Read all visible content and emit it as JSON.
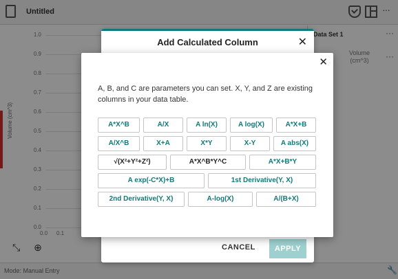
{
  "app": {
    "title": "Untitled"
  },
  "graph": {
    "y_ticks": [
      "1.0",
      "0.9",
      "0.8",
      "0.7",
      "0.6",
      "0.5",
      "0.4",
      "0.3",
      "0.2",
      "0.1",
      "0.0"
    ],
    "y_label": "Volume (cm^3)",
    "x_ticks": [
      "0.0",
      "0.1"
    ]
  },
  "table": {
    "dataset_title": "Data Set 1",
    "column_name_line1": "Volume",
    "column_name_line2": "(cm^3)"
  },
  "status": {
    "mode": "Mode: Manual Entry"
  },
  "dialog": {
    "title": "Add Calculated Column",
    "close_glyph": "✕",
    "cancel_label": "CANCEL",
    "apply_label": "APPLY"
  },
  "chooser": {
    "close_glyph": "✕",
    "description": "A, B, and C are parameters you can set. X, Y, and Z are existing columns in your data table.",
    "formulas": {
      "r1": [
        "A*X^B",
        "A/X",
        "A ln(X)",
        "A log(X)",
        "A*X+B"
      ],
      "r2": [
        "A/X^B",
        "X+A",
        "X*Y",
        "X-Y",
        "A abs(X)"
      ],
      "r3": [
        "√(X²+Y²+Z²)",
        "A*X^B*Y^C",
        "A*X+B*Y"
      ],
      "r4": [
        "A exp(-C*X)+B",
        "1st Derivative(Y, X)"
      ],
      "r5": [
        "2nd Derivative(Y, X)",
        "A-log(X)",
        "A/(B+X)"
      ]
    }
  }
}
